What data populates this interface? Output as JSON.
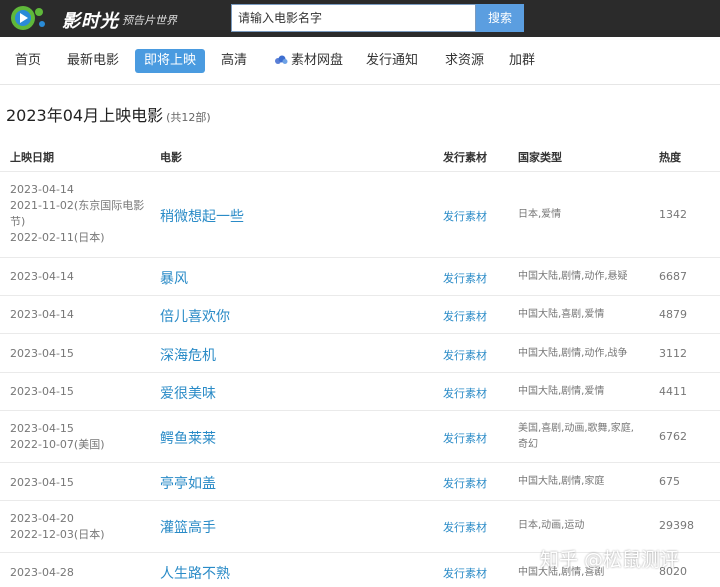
{
  "header": {
    "logo_title": "影时光",
    "logo_subtitle": "预告片世界",
    "search_placeholder": "请输入电影名字",
    "search_button": "搜索"
  },
  "nav": {
    "items": [
      {
        "label": "首页"
      },
      {
        "label": "最新电影"
      },
      {
        "label": "即将上映",
        "active": true
      },
      {
        "label": "高清"
      },
      {
        "label": "素材网盘",
        "icon": "cloud-icon"
      },
      {
        "label": "发行通知"
      },
      {
        "label": "求资源"
      },
      {
        "label": "加群"
      }
    ]
  },
  "section": {
    "title": "2023年04月上映电影",
    "count": "(共12部)"
  },
  "table": {
    "headers": {
      "date": "上映日期",
      "movie": "电影",
      "material": "发行素材",
      "genre": "国家类型",
      "heat": "热度"
    },
    "rows": [
      {
        "dates": [
          "2023-04-14",
          "2021-11-02(东京国际电影",
          "节)",
          "2022-02-11(日本)"
        ],
        "title": "稍微想起一些",
        "material": "发行素材",
        "genre": [
          "日本,爱情"
        ],
        "heat": "1342"
      },
      {
        "dates": [
          "2023-04-14"
        ],
        "title": "暴风",
        "material": "发行素材",
        "genre": [
          "中国大陆,剧情,动作,悬疑"
        ],
        "heat": "6687"
      },
      {
        "dates": [
          "2023-04-14"
        ],
        "title": "倍儿喜欢你",
        "material": "发行素材",
        "genre": [
          "中国大陆,喜剧,爱情"
        ],
        "heat": "4879"
      },
      {
        "dates": [
          "2023-04-15"
        ],
        "title": "深海危机",
        "material": "发行素材",
        "genre": [
          "中国大陆,剧情,动作,战争"
        ],
        "heat": "3112"
      },
      {
        "dates": [
          "2023-04-15"
        ],
        "title": "爱很美味",
        "material": "发行素材",
        "genre": [
          "中国大陆,剧情,爱情"
        ],
        "heat": "4411"
      },
      {
        "dates": [
          "2023-04-15",
          "2022-10-07(美国)"
        ],
        "title": "鳄鱼莱莱",
        "material": "发行素材",
        "genre": [
          "美国,喜剧,动画,歌舞,家庭,",
          "奇幻"
        ],
        "heat": "6762"
      },
      {
        "dates": [
          "2023-04-15"
        ],
        "title": "亭亭如盖",
        "material": "发行素材",
        "genre": [
          "中国大陆,剧情,家庭"
        ],
        "heat": "675"
      },
      {
        "dates": [
          "2023-04-20",
          "2022-12-03(日本)"
        ],
        "title": "灌篮高手",
        "material": "发行素材",
        "genre": [
          "日本,动画,运动"
        ],
        "heat": "29398"
      },
      {
        "dates": [
          "2023-04-28"
        ],
        "title": "人生路不熟",
        "material": "发行素材",
        "genre": [
          "中国大陆,剧情,喜剧"
        ],
        "heat": "8020"
      }
    ]
  },
  "watermark": "知乎 @松鼠测评",
  "colors": {
    "topbar": "#2b2b2b",
    "accent": "#4a9be0",
    "link": "#2a8bc7",
    "logo_green": "#5fb83a",
    "logo_blue": "#2a8bd7"
  }
}
